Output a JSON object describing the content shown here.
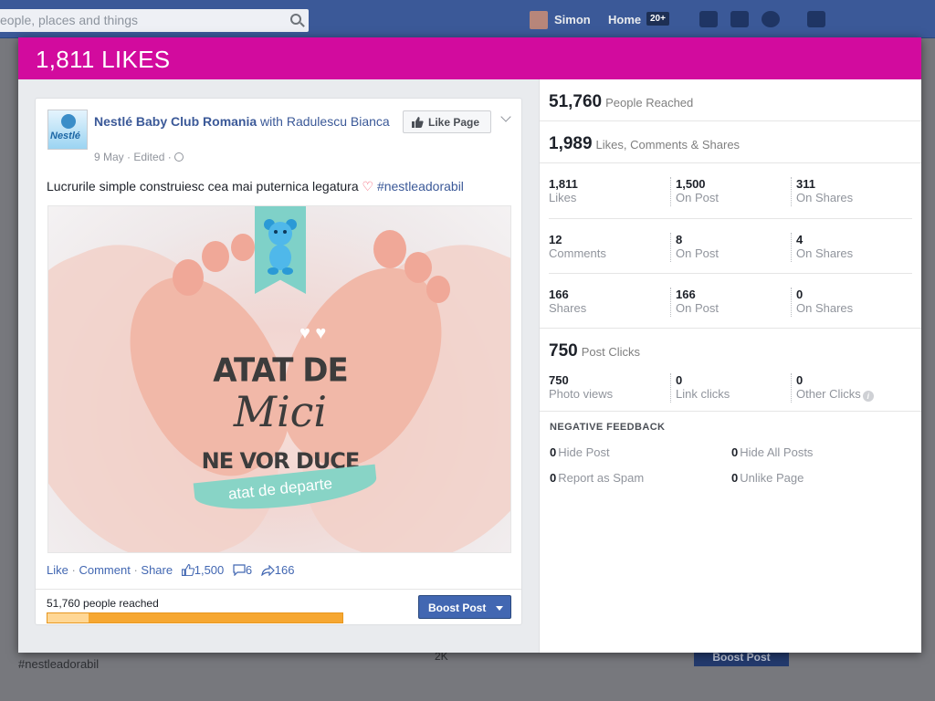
{
  "background": {
    "search_placeholder": "eople, places and things",
    "user_name": "Simon",
    "home_label": "Home",
    "home_badge": "20+",
    "left_hashtag": "#nestleadorabil",
    "boost_label": "Boost Post",
    "bg_stat": "2K"
  },
  "modal": {
    "title": "1,811 LIKES"
  },
  "post": {
    "page_name": "Nestlé Baby Club Romania",
    "with_text": "with Radulescu Bianca",
    "meta": "9 May · Edited ·",
    "like_page_label": "Like Page",
    "text": "Lucrurile simple construiesc cea mai puternica legatura",
    "heart": "♡",
    "hashtag": "#nestleadorabil",
    "image_text": {
      "line1": "ATAT DE",
      "line2": "Mici",
      "line3": "NE VOR DUCE",
      "banner": "atat de departe"
    },
    "actions": {
      "like": "Like",
      "comment": "Comment",
      "share": "Share",
      "likes_count": "1,500",
      "comments_count": "6",
      "shares_count": "166"
    },
    "reach_text": "51,760 people reached",
    "reach_fraction": 0.14,
    "boost_label": "Boost Post"
  },
  "stats": {
    "people_reached": {
      "value": "51,760",
      "label": "People Reached"
    },
    "engagement": {
      "value": "1,989",
      "label": "Likes, Comments & Shares"
    },
    "grid": [
      [
        {
          "num": "1,811",
          "lbl": "Likes"
        },
        {
          "num": "1,500",
          "lbl": "On Post"
        },
        {
          "num": "311",
          "lbl": "On Shares"
        }
      ],
      [
        {
          "num": "12",
          "lbl": "Comments"
        },
        {
          "num": "8",
          "lbl": "On Post"
        },
        {
          "num": "4",
          "lbl": "On Shares"
        }
      ],
      [
        {
          "num": "166",
          "lbl": "Shares"
        },
        {
          "num": "166",
          "lbl": "On Post"
        },
        {
          "num": "0",
          "lbl": "On Shares"
        }
      ]
    ],
    "post_clicks": {
      "value": "750",
      "label": "Post Clicks"
    },
    "clicks": [
      {
        "num": "750",
        "lbl": "Photo views"
      },
      {
        "num": "0",
        "lbl": "Link clicks"
      },
      {
        "num": "0",
        "lbl": "Other Clicks"
      }
    ],
    "negative_feedback": {
      "title": "NEGATIVE FEEDBACK",
      "items": [
        {
          "num": "0",
          "lbl": "Hide Post"
        },
        {
          "num": "0",
          "lbl": "Hide All Posts"
        },
        {
          "num": "0",
          "lbl": "Report as Spam"
        },
        {
          "num": "0",
          "lbl": "Unlike Page"
        }
      ]
    }
  },
  "colors": {
    "modal_header": "#d20b9e",
    "facebook_blue": "#3b5998",
    "boost_button": "#4267b2",
    "reach_bar": "#f6a731"
  },
  "icons": [
    "search-icon",
    "thumb-up-icon",
    "chevron-down-icon",
    "globe-icon",
    "comment-icon",
    "share-arrow-icon",
    "caret-down-icon",
    "info-icon",
    "bear-logo-icon"
  ]
}
